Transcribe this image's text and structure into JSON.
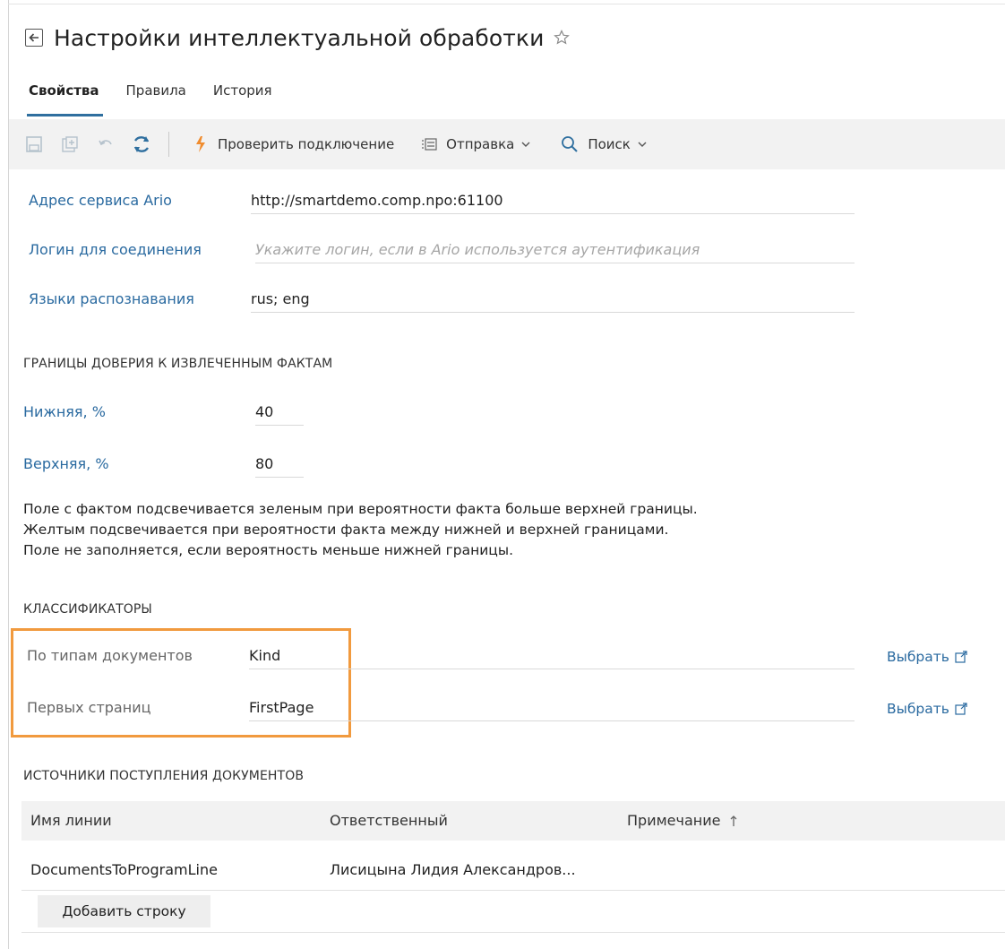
{
  "header": {
    "title": "Настройки интеллектуальной обработки"
  },
  "tabs": [
    {
      "label": "Свойства",
      "active": true
    },
    {
      "label": "Правила",
      "active": false
    },
    {
      "label": "История",
      "active": false
    }
  ],
  "toolbar": {
    "check_connection": "Проверить подключение",
    "send": "Отправка",
    "search": "Поиск"
  },
  "form": {
    "service_address": {
      "label": "Адрес сервиса Ario",
      "value": "http://smartdemo.comp.npo:61100"
    },
    "login": {
      "label": "Логин для соединения",
      "placeholder": "Укажите логин, если в Ario используется аутентификация"
    },
    "languages": {
      "label": "Языки распознавания",
      "value": "rus; eng"
    }
  },
  "confidence": {
    "section_title": "ГРАНИЦЫ ДОВЕРИЯ К ИЗВЛЕЧЕННЫМ ФАКТАМ",
    "lower": {
      "label": "Нижняя, %",
      "value": "40"
    },
    "upper": {
      "label": "Верхняя, %",
      "value": "80"
    },
    "note_lines": [
      "Поле с фактом подсвечивается зеленым при вероятности факта больше верхней границы.",
      "Желтым подсвечивается при вероятности факта между нижней и верхней границами.",
      "Поле не заполняется, если вероятность меньше нижней границы."
    ]
  },
  "classifiers": {
    "section_title": "КЛАССИФИКАТОРЫ",
    "by_doc_type": {
      "label": "По типам документов",
      "value": "Kind",
      "action": "Выбрать"
    },
    "first_pages": {
      "label": "Первых страниц",
      "value": "FirstPage",
      "action": "Выбрать"
    }
  },
  "sources": {
    "section_title": "ИСТОЧНИКИ ПОСТУПЛЕНИЯ ДОКУМЕНТОВ",
    "columns": [
      "Имя линии",
      "Ответственный",
      "Примечание"
    ],
    "rows": [
      [
        "DocumentsToProgramLine",
        "Лисицына Лидия Александров...",
        ""
      ]
    ],
    "add_row": "Добавить строку"
  },
  "colors": {
    "accent": "#2a6aa0",
    "highlight": "#f19a3e",
    "toolbar_bg": "#f2f2f2"
  }
}
